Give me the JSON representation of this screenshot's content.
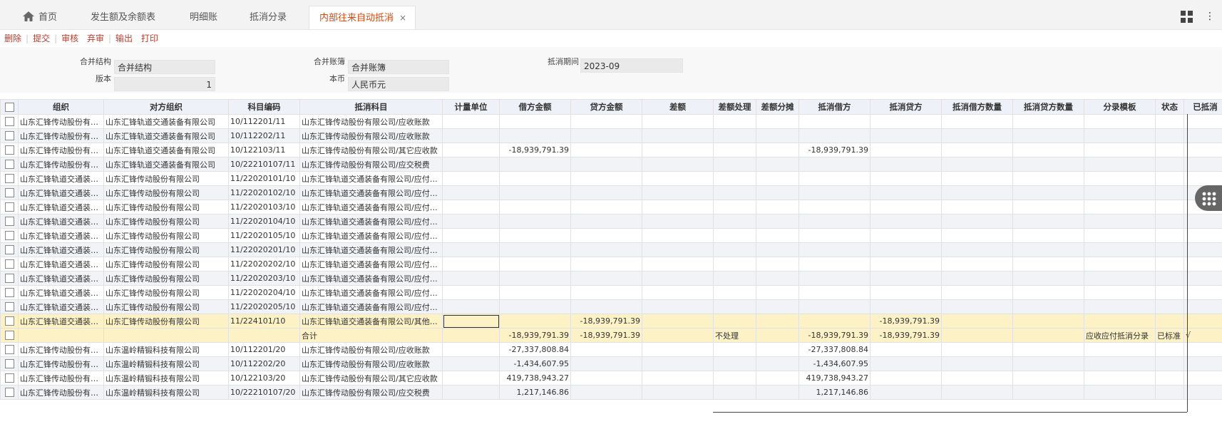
{
  "tabs": [
    {
      "label": "首页"
    },
    {
      "label": "发生额及余额表"
    },
    {
      "label": "明细账"
    },
    {
      "label": "抵消分录"
    },
    {
      "label": "内部往来自动抵消"
    }
  ],
  "tab_close": "×",
  "toolbar": [
    "删除",
    "提交",
    "审核",
    "弃审",
    "输出",
    "打印"
  ],
  "form": {
    "merge_struct_label": "合并结构",
    "merge_struct_value": "合并结构",
    "version_label": "版本",
    "version_value": "1",
    "merge_book_label": "合并账簿",
    "merge_book_value": "合并账簿",
    "currency_label": "本币",
    "currency_value": "人民币元",
    "period_label": "抵消期间",
    "period_value": "2023-09"
  },
  "table": {
    "headers": [
      "组织",
      "对方组织",
      "科目编码",
      "抵消科目",
      "计量单位",
      "借方金额",
      "贷方金额",
      "差额",
      "差额处理",
      "差额分摊",
      "抵消借方",
      "抵消贷方",
      "抵消借方数量",
      "抵消贷方数量",
      "分录模板",
      "状态",
      "已抵消"
    ],
    "rows": [
      [
        "山东汇锋传动股份有限公司",
        "山东汇锋轨道交通装备有限公司",
        "10/112201/11",
        "山东汇锋传动股份有限公司/应收账款",
        "",
        "",
        "",
        "",
        "",
        "",
        "",
        "",
        "",
        "",
        "",
        "",
        ""
      ],
      [
        "山东汇锋传动股份有限公司",
        "山东汇锋轨道交通装备有限公司",
        "10/112202/11",
        "山东汇锋传动股份有限公司/应收账款",
        "",
        "",
        "",
        "",
        "",
        "",
        "",
        "",
        "",
        "",
        "",
        "",
        ""
      ],
      [
        "山东汇锋传动股份有限公司",
        "山东汇锋轨道交通装备有限公司",
        "10/122103/11",
        "山东汇锋传动股份有限公司/其它应收款",
        "",
        "-18,939,791.39",
        "",
        "",
        "",
        "",
        "-18,939,791.39",
        "",
        "",
        "",
        "",
        "",
        ""
      ],
      [
        "山东汇锋传动股份有限公司",
        "山东汇锋轨道交通装备有限公司",
        "10/22210107/11",
        "山东汇锋传动股份有限公司/应交税费",
        "",
        "",
        "",
        "",
        "",
        "",
        "",
        "",
        "",
        "",
        "",
        "",
        ""
      ],
      [
        "山东汇锋轨道交通装备有限公司",
        "山东汇锋传动股份有限公司",
        "11/22020101/10",
        "山东汇锋轨道交通装备有限公司/应付账款",
        "",
        "",
        "",
        "",
        "",
        "",
        "",
        "",
        "",
        "",
        "",
        "",
        ""
      ],
      [
        "山东汇锋轨道交通装备有限公司",
        "山东汇锋传动股份有限公司",
        "11/22020102/10",
        "山东汇锋轨道交通装备有限公司/应付账款",
        "",
        "",
        "",
        "",
        "",
        "",
        "",
        "",
        "",
        "",
        "",
        "",
        ""
      ],
      [
        "山东汇锋轨道交通装备有限公司",
        "山东汇锋传动股份有限公司",
        "11/22020103/10",
        "山东汇锋轨道交通装备有限公司/应付账款",
        "",
        "",
        "",
        "",
        "",
        "",
        "",
        "",
        "",
        "",
        "",
        "",
        ""
      ],
      [
        "山东汇锋轨道交通装备有限公司",
        "山东汇锋传动股份有限公司",
        "11/22020104/10",
        "山东汇锋轨道交通装备有限公司/应付账款",
        "",
        "",
        "",
        "",
        "",
        "",
        "",
        "",
        "",
        "",
        "",
        "",
        ""
      ],
      [
        "山东汇锋轨道交通装备有限公司",
        "山东汇锋传动股份有限公司",
        "11/22020105/10",
        "山东汇锋轨道交通装备有限公司/应付账款",
        "",
        "",
        "",
        "",
        "",
        "",
        "",
        "",
        "",
        "",
        "",
        "",
        ""
      ],
      [
        "山东汇锋轨道交通装备有限公司",
        "山东汇锋传动股份有限公司",
        "11/22020201/10",
        "山东汇锋轨道交通装备有限公司/应付账款",
        "",
        "",
        "",
        "",
        "",
        "",
        "",
        "",
        "",
        "",
        "",
        "",
        ""
      ],
      [
        "山东汇锋轨道交通装备有限公司",
        "山东汇锋传动股份有限公司",
        "11/22020202/10",
        "山东汇锋轨道交通装备有限公司/应付账款",
        "",
        "",
        "",
        "",
        "",
        "",
        "",
        "",
        "",
        "",
        "",
        "",
        ""
      ],
      [
        "山东汇锋轨道交通装备有限公司",
        "山东汇锋传动股份有限公司",
        "11/22020203/10",
        "山东汇锋轨道交通装备有限公司/应付账款",
        "",
        "",
        "",
        "",
        "",
        "",
        "",
        "",
        "",
        "",
        "",
        "",
        ""
      ],
      [
        "山东汇锋轨道交通装备有限公司",
        "山东汇锋传动股份有限公司",
        "11/22020204/10",
        "山东汇锋轨道交通装备有限公司/应付账款",
        "",
        "",
        "",
        "",
        "",
        "",
        "",
        "",
        "",
        "",
        "",
        "",
        ""
      ],
      [
        "山东汇锋轨道交通装备有限公司",
        "山东汇锋传动股份有限公司",
        "11/22020205/10",
        "山东汇锋轨道交通装备有限公司/应付账款",
        "",
        "",
        "",
        "",
        "",
        "",
        "",
        "",
        "",
        "",
        "",
        "",
        ""
      ],
      [
        "山东汇锋轨道交通装备有限公司",
        "山东汇锋传动股份有限公司",
        "11/224101/10",
        "山东汇锋轨道交通装备有限公司/其他应付款",
        "",
        "",
        "-18,939,791.39",
        "",
        "",
        "",
        "",
        "-18,939,791.39",
        "",
        "",
        "",
        "",
        ""
      ],
      [
        "",
        "",
        "",
        "合计",
        "",
        "-18,939,791.39",
        "-18,939,791.39",
        "",
        "不处理",
        "",
        "-18,939,791.39",
        "-18,939,791.39",
        "",
        "",
        "应收应付抵消分录",
        "已标准",
        "√"
      ],
      [
        "山东汇锋传动股份有限公司",
        "山东温岭精锻科技有限公司",
        "10/112201/20",
        "山东汇锋传动股份有限公司/应收账款",
        "",
        "-27,337,808.84",
        "",
        "",
        "",
        "",
        "-27,337,808.84",
        "",
        "",
        "",
        "",
        "",
        ""
      ],
      [
        "山东汇锋传动股份有限公司",
        "山东温岭精锻科技有限公司",
        "10/112202/20",
        "山东汇锋传动股份有限公司/应收账款",
        "",
        "-1,434,607.95",
        "",
        "",
        "",
        "",
        "-1,434,607.95",
        "",
        "",
        "",
        "",
        "",
        ""
      ],
      [
        "山东汇锋传动股份有限公司",
        "山东温岭精锻科技有限公司",
        "10/122103/20",
        "山东汇锋传动股份有限公司/其它应收款",
        "",
        "419,738,943.27",
        "",
        "",
        "",
        "",
        "419,738,943.27",
        "",
        "",
        "",
        "",
        "",
        ""
      ],
      [
        "山东汇锋传动股份有限公司",
        "山东温岭精锻科技有限公司",
        "10/22210107/20",
        "山东汇锋传动股份有限公司/应交税费",
        "",
        "1,217,146.86",
        "",
        "",
        "",
        "",
        "1,217,146.86",
        "",
        "",
        "",
        "",
        "",
        ""
      ]
    ]
  },
  "colors": {
    "accent": "#d9480f",
    "header_bg": "#eef1f7",
    "selected_row": "#fdf1c6",
    "alt_row": "#f2f3f7"
  },
  "icons": [
    "home-icon",
    "grid-menu-icon",
    "more-vertical-icon",
    "floating-dots-icon",
    "checkbox-icon"
  ]
}
